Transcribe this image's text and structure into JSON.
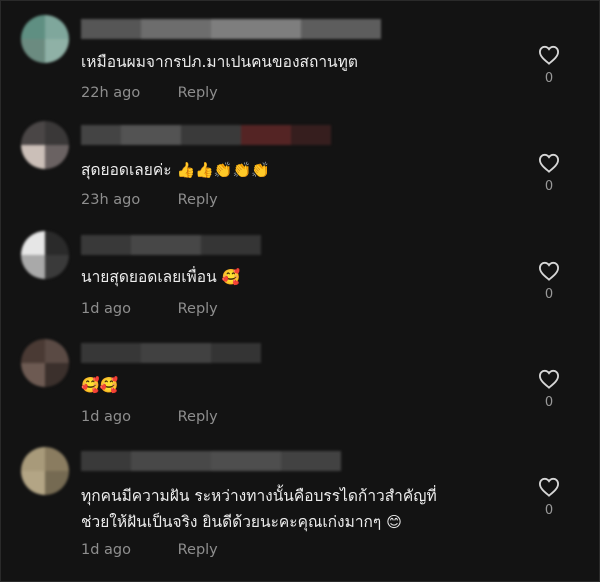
{
  "comments": [
    {
      "text": "เหมือนผมจากรปภ.มาเปนคนของสถานทูต",
      "emoji": "",
      "time": "22h ago",
      "reply": "Reply",
      "likes": "0"
    },
    {
      "text": "สุดยอดเลยค่ะ",
      "emoji": "👍👍👏👏👏",
      "time": "23h ago",
      "reply": "Reply",
      "likes": "0"
    },
    {
      "text": "นายสุดยอดเลยเพื่อน",
      "emoji": "🥰",
      "time": "1d ago",
      "reply": "Reply",
      "likes": "0"
    },
    {
      "text": "",
      "emoji": "🥰🥰",
      "time": "1d ago",
      "reply": "Reply",
      "likes": "0"
    },
    {
      "text": "ทุกคนมีความฝัน ระหว่างทางนั้นคือบรรไดก้าวสำคัญที่",
      "text2": "ช่วยให้ฝันเป็นจริง ยินดีด้วยนะคะคุณเก่งมากๆ",
      "emoji": "😊",
      "time": "1d ago",
      "reply": "Reply",
      "likes": "0"
    }
  ]
}
